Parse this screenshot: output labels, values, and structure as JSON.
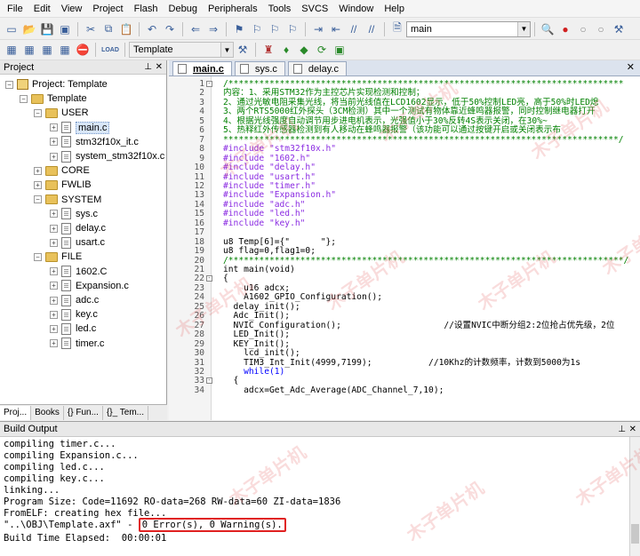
{
  "menu": [
    "File",
    "Edit",
    "View",
    "Project",
    "Flash",
    "Debug",
    "Peripherals",
    "Tools",
    "SVCS",
    "Window",
    "Help"
  ],
  "toolbar": {
    "search_value": "main",
    "target_value": "Template",
    "load_label": "LOAD"
  },
  "project_panel": {
    "title": "Project",
    "root": "Project: Template",
    "target": "Template",
    "groups": [
      {
        "name": "USER",
        "files": [
          "main.c",
          "stm32f10x_it.c",
          "system_stm32f10x.c"
        ]
      },
      {
        "name": "CORE",
        "files": []
      },
      {
        "name": "FWLIB",
        "files": []
      },
      {
        "name": "SYSTEM",
        "files": [
          "sys.c",
          "delay.c",
          "usart.c"
        ]
      },
      {
        "name": "FILE",
        "files": [
          "1602.C",
          "Expansion.c",
          "adc.c",
          "key.c",
          "led.c",
          "timer.c"
        ]
      }
    ],
    "bottom_tabs": [
      "Proj...",
      "Books",
      "{} Fun...",
      "{}_ Tem..."
    ]
  },
  "editor": {
    "tabs": [
      "main.c",
      "sys.c",
      "delay.c"
    ],
    "lines": [
      {
        "n": "1",
        "fold": "-",
        "cls": "c-comment",
        "t": "/*****************************************************************************"
      },
      {
        "n": "2",
        "fold": "",
        "cls": "c-comment",
        "t": "内容：1、采用STM32作为主控芯片实现检测和控制；"
      },
      {
        "n": "3",
        "fold": "",
        "cls": "c-comment",
        "t": "2、通过光敏电阻采集光线，将当前光线值在LCD1602显示，低于50%控制LED亮，高于50%时LED熄"
      },
      {
        "n": "4",
        "fold": "",
        "cls": "c-comment",
        "t": "3、两个RTS5000红外探头（3CM检测）其中一个测试有物体靠近蜂鸣器报警，同时控制继电器打开"
      },
      {
        "n": "5",
        "fold": "",
        "cls": "c-comment",
        "t": "4、根据光线强度自动调节用步进电机表示，光强值小于30%反转4S表示关闭，在30%~"
      },
      {
        "n": "6",
        "fold": "",
        "cls": "c-comment",
        "t": "5、热释红外传感器检测到有人移动在蜂鸣器报警（该功能可以通过按键开启或关闭表示布"
      },
      {
        "n": "7",
        "fold": "",
        "cls": "c-comment",
        "t": "*****************************************************************************/"
      },
      {
        "n": "8",
        "fold": "",
        "cls": "c-pre",
        "t": "#include \"stm32f10x.h\""
      },
      {
        "n": "9",
        "fold": "",
        "cls": "c-pre",
        "t": "#include \"1602.h\""
      },
      {
        "n": "10",
        "fold": "",
        "cls": "c-pre",
        "t": "#include \"delay.h\""
      },
      {
        "n": "11",
        "fold": "",
        "cls": "c-pre",
        "t": "#include \"usart.h\""
      },
      {
        "n": "12",
        "fold": "",
        "cls": "c-pre",
        "t": "#include \"timer.h\""
      },
      {
        "n": "13",
        "fold": "",
        "cls": "c-pre",
        "t": "#include \"Expansion.h\""
      },
      {
        "n": "14",
        "fold": "",
        "cls": "c-pre",
        "t": "#include \"adc.h\""
      },
      {
        "n": "15",
        "fold": "",
        "cls": "c-pre",
        "t": "#include \"led.h\""
      },
      {
        "n": "16",
        "fold": "",
        "cls": "c-pre",
        "t": "#include \"key.h\""
      },
      {
        "n": "17",
        "fold": "",
        "cls": "c-norm",
        "t": ""
      },
      {
        "n": "18",
        "fold": "",
        "cls": "c-norm",
        "t": "u8 Temp[6]={\"      \"};"
      },
      {
        "n": "19",
        "fold": "",
        "cls": "c-norm",
        "t": "u8 flag=0,flag1=0;"
      },
      {
        "n": "20",
        "fold": "",
        "cls": "c-comment",
        "t": "/*****************************************************************************/"
      },
      {
        "n": "21",
        "fold": "",
        "cls": "c-norm",
        "t": "int main(void)"
      },
      {
        "n": "22",
        "fold": "-",
        "cls": "c-norm",
        "t": "{"
      },
      {
        "n": "23",
        "fold": "",
        "cls": "c-norm",
        "t": "    u16 adcx;"
      },
      {
        "n": "24",
        "fold": "",
        "cls": "c-norm",
        "t": "    A1602_GPIO_Configuration();"
      },
      {
        "n": "25",
        "fold": "",
        "cls": "c-norm",
        "t": "  delay_init();"
      },
      {
        "n": "26",
        "fold": "",
        "cls": "c-norm",
        "t": "  Adc_Init();"
      },
      {
        "n": "27",
        "fold": "",
        "cls": "c-norm",
        "t": "  NVIC_Configuration();                    //设置NVIC中断分组2:2位抢占优先级，2位"
      },
      {
        "n": "28",
        "fold": "",
        "cls": "c-norm",
        "t": "  LED_Init();"
      },
      {
        "n": "29",
        "fold": "",
        "cls": "c-norm",
        "t": "  KEY_Init();"
      },
      {
        "n": "30",
        "fold": "",
        "cls": "c-norm",
        "t": "    lcd_init();"
      },
      {
        "n": "31",
        "fold": "",
        "cls": "c-norm",
        "t": "    TIM3_Int_Init(4999,7199);           //10Khz的计数频率，计数到5000为1s"
      },
      {
        "n": "32",
        "fold": "",
        "cls": "c-kw",
        "t": "    while(1)"
      },
      {
        "n": "33",
        "fold": "-",
        "cls": "c-norm",
        "t": "  {"
      },
      {
        "n": "34",
        "fold": "",
        "cls": "c-norm",
        "t": "    adcx=Get_Adc_Average(ADC_Channel_7,10);"
      }
    ]
  },
  "build": {
    "title": "Build Output",
    "lines": [
      "compiling timer.c...",
      "compiling Expansion.c...",
      "compiling led.c...",
      "compiling key.c...",
      "linking...",
      "Program Size: Code=11692 RO-data=268 RW-data=60 ZI-data=1836",
      "FromELF: creating hex file..."
    ],
    "result_prefix": "\"..\\OBJ\\Template.axf\" - ",
    "result_errors": "0 Error(s), 0 Warning(s).",
    "elapsed": "Build Time Elapsed:  00:00:01"
  },
  "watermark": "木子单片机",
  "colors": {
    "comment": "#008000",
    "preprocessor": "#8a2be2",
    "keyword": "#0000ff",
    "error_box": "#e02020"
  }
}
